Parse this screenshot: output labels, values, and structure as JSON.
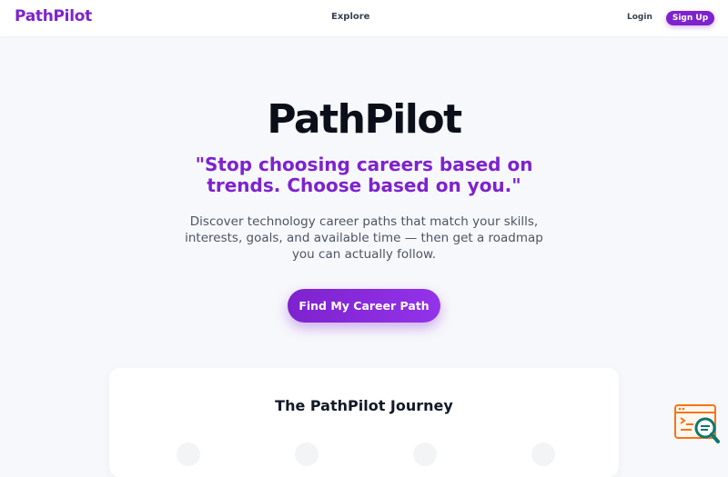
{
  "nav": {
    "brand": "PathPilot",
    "explore": "Explore",
    "login": "Login",
    "signup": "Sign Up"
  },
  "hero": {
    "title": "PathPilot",
    "quote": "\"Stop choosing careers based on trends. Choose based on you.\"",
    "description": "Discover technology career paths that match your skills, interests, goals, and available time — then get a roadmap you can actually follow.",
    "cta": "Find My Career Path"
  },
  "journey": {
    "title": "The PathPilot Journey"
  },
  "colors": {
    "accent": "#7e22ce",
    "background": "#f7f8fb",
    "widget": "#f97316"
  },
  "icons": {
    "helper_widget": "code-window-search-icon"
  }
}
